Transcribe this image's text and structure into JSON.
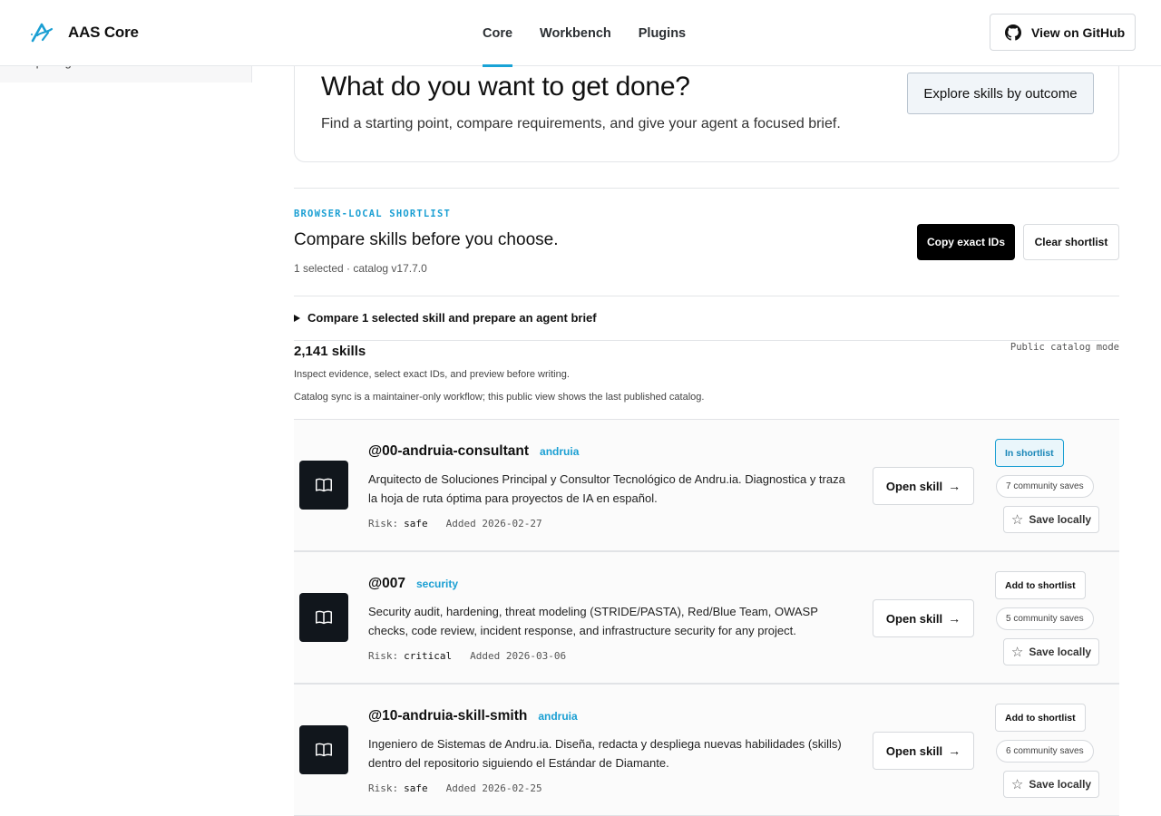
{
  "header": {
    "brand_name": "AAS Core",
    "tabs": [
      {
        "label": "Core",
        "active": true
      },
      {
        "label": "Workbench",
        "active": false
      },
      {
        "label": "Plugins",
        "active": false
      }
    ],
    "github_label": "View on GitHub"
  },
  "colors": {
    "accent": "#1a9fd3",
    "dark_button": "#000000",
    "thumb_bg": "#11161c"
  },
  "hero": {
    "title": "What do you want to get done?",
    "subtitle": "Find a starting point, compare requirements, and give your agent a focused brief.",
    "explore_label": "Explore skills by outcome"
  },
  "shortlist": {
    "eyebrow": "BROWSER-LOCAL SHORTLIST",
    "title": "Compare skills before you choose.",
    "meta": "1 selected · catalog v17.7.0",
    "copy_label": "Copy exact IDs",
    "clear_label": "Clear shortlist",
    "compare_label": "Compare 1 selected skill and prepare an agent brief"
  },
  "catalog": {
    "count": "2,141 skills",
    "mode": "Public catalog mode",
    "inspect_text": "Inspect evidence, select exact IDs, and preview before writing.",
    "sync_text": "Catalog sync is a maintainer-only workflow; this public view shows the last published catalog."
  },
  "skills": [
    {
      "name": "@00-andruia-consultant",
      "tag": "andruia",
      "description": "Arquitecto de Soluciones Principal y Consultor Tecnológico de Andru.ia. Diagnostica y traza la hoja de ruta óptima para proyectos de IA en español.",
      "risk_label": "Risk:",
      "risk": "safe",
      "added": "Added 2026-02-27",
      "open_label": "Open skill",
      "shortlist_label": "In shortlist",
      "in_shortlist": true,
      "saves": "7 community saves",
      "save_label": "Save locally"
    },
    {
      "name": "@007",
      "tag": "security",
      "description": "Security audit, hardening, threat modeling (STRIDE/PASTA), Red/Blue Team, OWASP checks, code review, incident response, and infrastructure security for any project.",
      "risk_label": "Risk:",
      "risk": "critical",
      "added": "Added 2026-03-06",
      "open_label": "Open skill",
      "shortlist_label": "Add to shortlist",
      "in_shortlist": false,
      "saves": "5 community saves",
      "save_label": "Save locally"
    },
    {
      "name": "@10-andruia-skill-smith",
      "tag": "andruia",
      "description": "Ingeniero de Sistemas de Andru.ia. Diseña, redacta y despliega nuevas habilidades (skills) dentro del repositorio siguiendo el Estándar de Diamante.",
      "risk_label": "Risk:",
      "risk": "safe",
      "added": "Added 2026-02-25",
      "open_label": "Open skill",
      "shortlist_label": "Add to shortlist",
      "in_shortlist": false,
      "saves": "6 community saves",
      "save_label": "Save locally"
    }
  ]
}
